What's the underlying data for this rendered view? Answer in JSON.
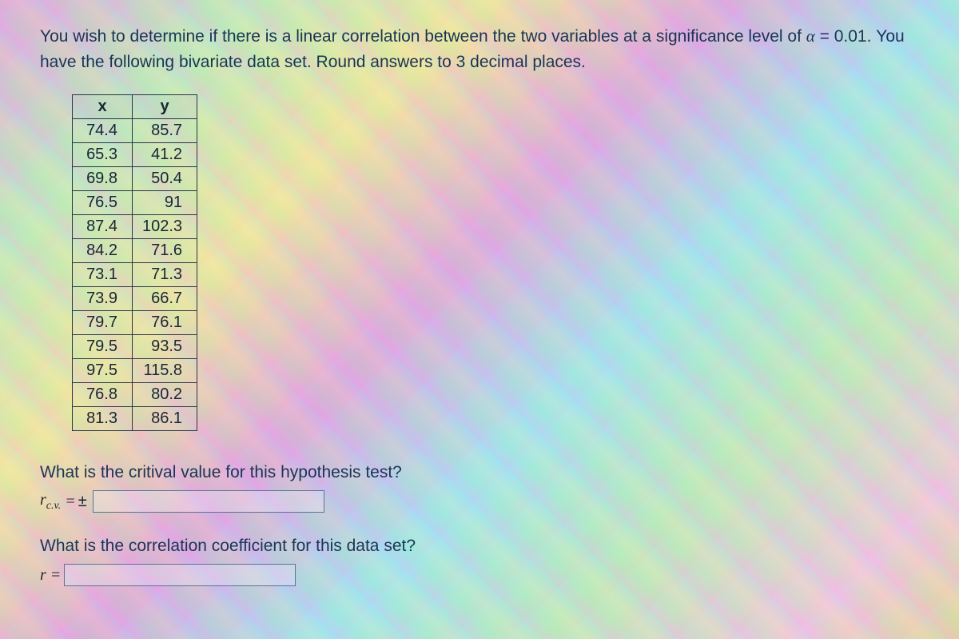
{
  "intro": {
    "part1": "You wish to determine if there is a linear correlation between the two variables at a significance level of ",
    "alpha_sym": "α",
    "equals": " = ",
    "alpha_val": "0.01",
    "part2": ". You have the following bivariate data set. Round answers to 3 decimal places."
  },
  "table": {
    "header_x": "x",
    "header_y": "y",
    "rows": [
      {
        "x": "74.4",
        "y": "85.7"
      },
      {
        "x": "65.3",
        "y": "41.2"
      },
      {
        "x": "69.8",
        "y": "50.4"
      },
      {
        "x": "76.5",
        "y": "91"
      },
      {
        "x": "87.4",
        "y": "102.3"
      },
      {
        "x": "84.2",
        "y": "71.6"
      },
      {
        "x": "73.1",
        "y": "71.3"
      },
      {
        "x": "73.9",
        "y": "66.7"
      },
      {
        "x": "79.7",
        "y": "76.1"
      },
      {
        "x": "79.5",
        "y": "93.5"
      },
      {
        "x": "97.5",
        "y": "115.8"
      },
      {
        "x": "76.8",
        "y": "80.2"
      },
      {
        "x": "81.3",
        "y": "86.1"
      }
    ]
  },
  "q1": {
    "text": "What is the critival value for this hypothesis test?",
    "label_r": "r",
    "label_sub": "c.v.",
    "equals": " = ",
    "plusminus": "±",
    "value": ""
  },
  "q2": {
    "text": "What is the correlation coefficient for this data set?",
    "label_r": "r",
    "equals": " = ",
    "value": ""
  }
}
